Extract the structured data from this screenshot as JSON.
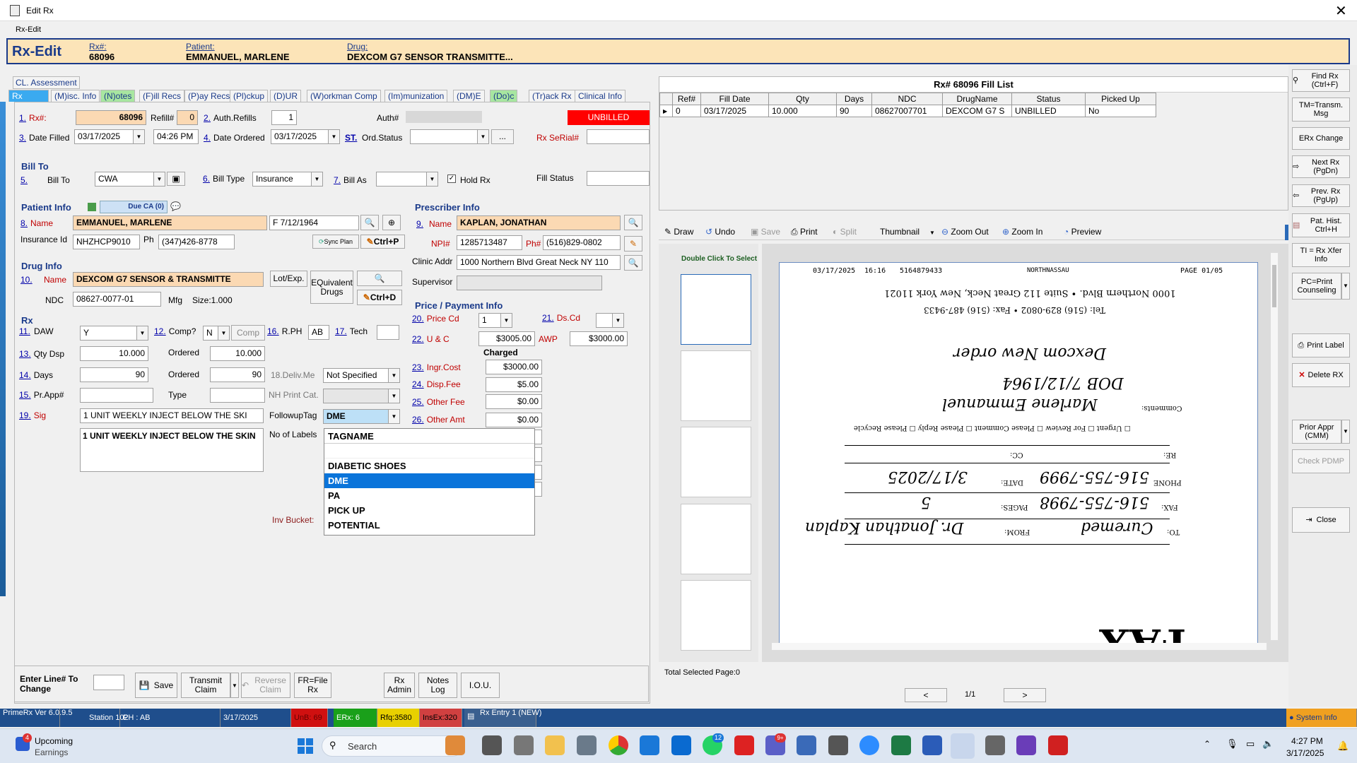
{
  "window": {
    "title": "Edit Rx",
    "subtitle": "Rx-Edit"
  },
  "header": {
    "title": "Rx-Edit",
    "rx_label": "Rx#:",
    "rx_value": "68096",
    "patient_label": "Patient:",
    "patient_value": "EMMANUEL, MARLENE",
    "drug_label": "Drug:",
    "drug_value": "DEXCOM G7 SENSOR TRANSMITTE..."
  },
  "cl_tab": "CL. Assessment",
  "tabs": [
    {
      "label": "Rx"
    },
    {
      "label": "(M)isc. Info"
    },
    {
      "label": "(N)otes"
    },
    {
      "label": "(F)ill Recs"
    },
    {
      "label": "(P)ay Recs"
    },
    {
      "label": "(Pl)ckup"
    },
    {
      "label": "(D)UR"
    },
    {
      "label": "(W)orkman Comp"
    },
    {
      "label": "(Im)munization"
    },
    {
      "label": "(DM)E"
    },
    {
      "label": "(Do)c"
    },
    {
      "label": "(Tr)ack Rx"
    },
    {
      "label": "Clinical Info"
    }
  ],
  "rx": {
    "rx_num_label": "Rx#:",
    "rx_num": "68096",
    "refill_label": "Refill#",
    "refill": "0",
    "auth_refills_label": "Auth.Refills",
    "auth_refills": "1",
    "auth_label": "Auth#",
    "status": "UNBILLED",
    "date_filled_label": "Date Filled",
    "date_filled": "03/17/2025",
    "time": "04:26 PM",
    "date_ordered_label": "Date Ordered",
    "date_ordered": "03/17/2025",
    "st_label": "ST.",
    "ord_status_label": "Ord.Status",
    "ellipsis": "...",
    "serial_label": "Rx SeRial#",
    "bill_to_section": "Bill To",
    "bill_to_label": "Bill To",
    "bill_to": "CWA",
    "bill_type_label": "Bill Type",
    "bill_type": "Insurance",
    "bill_as_label": "Bill As",
    "hold_rx_label": "Hold Rx",
    "fill_status_label": "Fill Status",
    "n1": "1.",
    "n3": "3.",
    "n2": "2.",
    "n4": "4.",
    "n5": "5.",
    "n6": "6.",
    "n7": "7.",
    "n8": "8.",
    "n9": "9.",
    "n10": "10.",
    "n11": "11.",
    "n12": "12.",
    "n13": "13.",
    "n14": "14.",
    "n15": "15.",
    "n16": "16.",
    "n17": "17.",
    "n19": "19.",
    "n20": "20.",
    "n21": "21.",
    "n22": "22.",
    "n23": "23.",
    "n24": "24.",
    "n25": "25.",
    "n26": "26."
  },
  "patient": {
    "section": "Patient Info",
    "due_ca": "Due CA (0)",
    "name_label": "Name",
    "name": "EMMANUEL, MARLENE",
    "gender_dob": "F  7/12/1964",
    "ins_id_label": "Insurance Id",
    "ins_id": "NHZHCP9010",
    "ph_label": "Ph",
    "phone": "(347)426-8778",
    "sync_plan": "Sync Plan",
    "ctrl_p": "Ctrl+P"
  },
  "prescriber": {
    "section": "Prescriber Info",
    "name_label": "Name",
    "name": "KAPLAN, JONATHAN",
    "npi_label": "NPI#",
    "npi": "1285713487",
    "ph_label": "Ph#",
    "phone": "(516)829-0802",
    "clinic_label": "Clinic Addr",
    "clinic": "1000 Northern Blvd  Great Neck NY 110",
    "supervisor_label": "Supervisor"
  },
  "drug": {
    "section": "Drug Info",
    "name_label": "Name",
    "name": "DEXCOM G7 SENSOR & TRANSMITTE",
    "lot_exp": "Lot/Exp.",
    "equiv": "EQuivalent Drugs",
    "ndc_label": "NDC",
    "ndc": "08627-0077-01",
    "mfg_label": "Mfg",
    "size": "Size:1.000",
    "ctrl_d": "Ctrl+D"
  },
  "rxsec": {
    "section": "Rx",
    "daw_label": "DAW",
    "daw": "Y",
    "comp_label": "Comp?",
    "comp": "N",
    "comp_btn": "Comp",
    "rph_label": "R.PH",
    "rph": "AB",
    "tech_label": "Tech",
    "qty_label": "Qty Dsp",
    "qty": "10.000",
    "ordered_label": "Ordered",
    "qty_ordered": "10.000",
    "days_label": "Days",
    "days": "90",
    "days_ordered": "90",
    "deliv_label": "18.Deliv.Me",
    "deliv": "Not Specified",
    "prapp_label": "Pr.App#",
    "type_label": "Type",
    "nh_label": "NH Print Cat.",
    "sig_label": "Sig",
    "sig": "1 UNIT WEEKLY INJECT BELOW THE SKI",
    "sig_full": "1 UNIT WEEKLY INJECT BELOW THE SKIN",
    "followup_label": "FollowupTag",
    "followup": "DME",
    "labels_label": "No of Labels",
    "inv_label": "Inv Bucket:"
  },
  "dropdown": {
    "header": "TAGNAME",
    "options": [
      "",
      "DIABETIC SHOES",
      "DME",
      "PA",
      "PICK UP",
      "POTENTIAL"
    ],
    "selected": "DME"
  },
  "price": {
    "section": "Price / Payment Info",
    "price_cd_label": "Price Cd",
    "price_cd": "1",
    "ds_cd_label": "Ds.Cd",
    "uc_label": "U & C",
    "uc": "$3005.00",
    "awp_label": "AWP",
    "awp": "$3000.00",
    "charged_label": "Charged",
    "ingr_label": "Ingr.Cost",
    "ingr": "$3000.00",
    "disp_label": "Disp.Fee",
    "disp": "$5.00",
    "other_fee_label": "Other Fee",
    "other_fee": "$0.00",
    "other_amt_label": "Other Amt",
    "other_amt": "$0.00"
  },
  "bottom": {
    "enter_line": "Enter Line# To Change",
    "save": "Save",
    "transmit": "Transmit Claim",
    "reverse": "Reverse Claim",
    "fr_file": "FR=File Rx",
    "rx_admin": "Rx Admin",
    "notes_log": "Notes Log",
    "iou": "I.O.U."
  },
  "fill_list": {
    "title": "Rx# 68096 Fill List",
    "columns": [
      "Ref#",
      "Fill Date",
      "Qty",
      "Days",
      "NDC",
      "DrugName",
      "Status",
      "Picked Up"
    ],
    "rows": [
      [
        "0",
        "03/17/2025",
        "10.000",
        "90",
        "08627007701",
        "DEXCOM G7 S",
        "UNBILLED",
        "No"
      ]
    ]
  },
  "viewer": {
    "toolbar": [
      "Draw",
      "Undo",
      "Save",
      "Print",
      "Split",
      "Thumbnail",
      "Zoom Out",
      "Zoom In",
      "Preview"
    ],
    "thumb_hint": "Double  Click To Select",
    "total_selected": "Total Selected Page:0",
    "page": "1/1",
    "prev": "<",
    "next": ">"
  },
  "fax": {
    "hdr_date": "03/17/2025",
    "hdr_time": "16:16",
    "hdr_num": "5164879433",
    "hdr_name": "NORTHNASSAU",
    "hdr_page": "PAGE  01/05",
    "addr": "1000 Northern Blvd. • Suite 112  Great Neck, New York 11021",
    "tel": "Tel: (516) 829-0802 • Fax: (516) 487-9433",
    "hw1": "Dexcom New order",
    "hw2": "DOB 7/12/1964",
    "comments": "Comments:",
    "hw3": "Marlene Emmanuel",
    "checks": "☐ Urgent  ☐ For Review  ☐ Please Comment  ☐ Please Reply  ☐ Please Recycle",
    "re": "RE:",
    "cc": "CC:",
    "phone_lbl": "PHONE",
    "phone_hw": "516-755-7999",
    "date_lbl": "DATE:",
    "date_hw": "3/17/2025",
    "fax_lbl": "FAX:",
    "fax_hw": "516-755-7998",
    "pages_lbl": "PAGES:",
    "pages_hw": "5",
    "to_lbl": "TO:",
    "to_hw": "Curemed",
    "from_lbl": "FROM:",
    "from_hw": "Dr. Jonathan Kaplan",
    "big": "FAX"
  },
  "sidebar": [
    {
      "label": "Find Rx (Ctrl+F)"
    },
    {
      "label": "TM=Transm. Msg"
    },
    {
      "label": "ERx Change"
    },
    {
      "label": "Next Rx (PgDn)"
    },
    {
      "label": "Prev. Rx (PgUp)"
    },
    {
      "label": "Pat. Hist. Ctrl+H"
    },
    {
      "label": "TI = Rx Xfer Info"
    },
    {
      "label": "PC=Print Counseling"
    },
    {
      "label": "Print Label"
    },
    {
      "label": "Delete RX"
    },
    {
      "label": "Prior Appr (CMM)"
    },
    {
      "label": "Check PDMP"
    },
    {
      "label": "Close"
    }
  ],
  "status": {
    "ver": "PrimeRx Ver 6.0.9.5",
    "station": "Station 102",
    "ph": "PH : AB",
    "date": "3/17/2025",
    "unb": "UnB: 69",
    "erx": "ERx: 6",
    "rfq": "Rfq:3580",
    "insex": "InsEx:320",
    "entry": "Rx Entry 1 (NEW)",
    "sysinfo": "System Info"
  },
  "taskbar": {
    "weather_title": "Upcoming",
    "weather_sub": "Earnings",
    "badge": "4",
    "search": "Search",
    "time": "4:27 PM",
    "date": "3/17/2025",
    "badge_teams": "12",
    "badge_teams2": "9+"
  },
  "colors": {
    "accent": "#0a74da",
    "header_bg": "#fce4b8",
    "unbilled": "#ff0000",
    "status_blue": "#1f4e8c"
  }
}
